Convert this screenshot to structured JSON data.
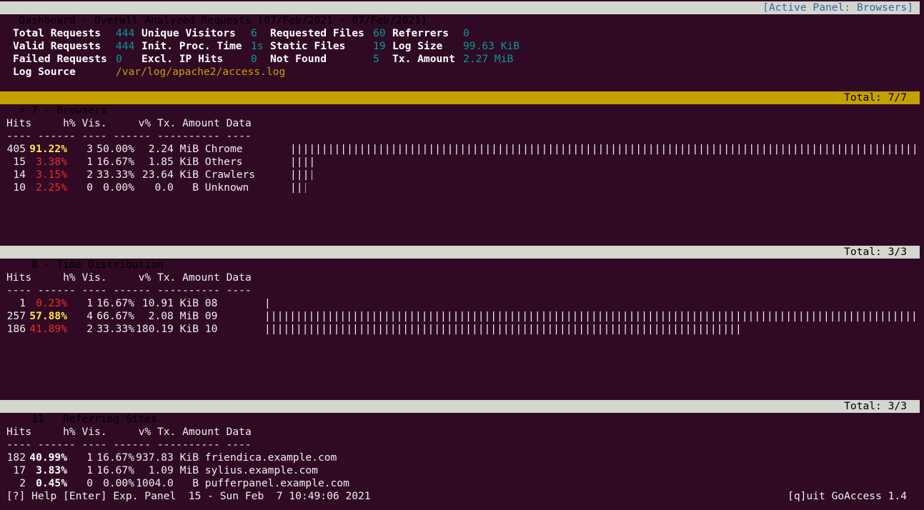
{
  "header": {
    "title": "Dashboard - Overall Analyzed Requests (07/Feb/2021 - 07/Feb/2021)",
    "active_panel": "[Active Panel: Browsers]"
  },
  "overview": {
    "total_requests_label": "Total Requests",
    "total_requests": "444",
    "unique_visitors_label": "Unique Visitors",
    "unique_visitors": "6",
    "requested_files_label": "Requested Files",
    "requested_files": "60",
    "referrers_label": "Referrers",
    "referrers": "0",
    "valid_requests_label": "Valid Requests",
    "valid_requests": "444",
    "init_proc_label": "Init. Proc. Time",
    "init_proc": "1s",
    "static_files_label": "Static Files",
    "static_files": "19",
    "log_size_label": "Log Size",
    "log_size": "99.63 KiB",
    "failed_requests_label": "Failed Requests",
    "failed_requests": "0",
    "excl_ip_label": "Excl. IP Hits",
    "excl_ip": "0",
    "not_found_label": "Not Found",
    "not_found": "5",
    "tx_amount_label": "Tx. Amount",
    "tx_amount": "2.27 MiB",
    "log_source_label": "Log Source",
    "log_source": "/var/log/apache2/access.log"
  },
  "columns": {
    "hits": "Hits",
    "hpct": "h%",
    "vis": "Vis.",
    "vpct": "v%",
    "tx": "Tx. Amount",
    "data": "Data",
    "sep": "---- ------ ---- ------ ---------- ----"
  },
  "panels": {
    "browsers": {
      "title": "> 7 - Browsers",
      "total": "Total: 7/7",
      "rows": [
        {
          "hits": "405",
          "hpct": "91.22%",
          "vis": "3",
          "vpct": "50.00%",
          "tx": "2.24 MiB",
          "data": "Chrome",
          "bar": 1.0
        },
        {
          "hits": "15",
          "hpct": "3.38%",
          "vis": "1",
          "vpct": "16.67%",
          "tx": "1.85 KiB",
          "data": "Others",
          "bar": 0.037
        },
        {
          "hits": "14",
          "hpct": "3.15%",
          "vis": "2",
          "vpct": "33.33%",
          "tx": "23.64 KiB",
          "data": "Crawlers",
          "bar": 0.035
        },
        {
          "hits": "10",
          "hpct": "2.25%",
          "vis": "0",
          "vpct": "0.00%",
          "tx": "0.0   B",
          "data": "Unknown",
          "bar": 0.025
        }
      ]
    },
    "time": {
      "title": "  8 - Time Distribution",
      "total": "Total: 3/3",
      "rows": [
        {
          "hits": "1",
          "hpct": "0.23%",
          "vis": "1",
          "vpct": "16.67%",
          "tx": "10.91 KiB",
          "data": "08",
          "bar": 0.004
        },
        {
          "hits": "257",
          "hpct": "57.88%",
          "vis": "4",
          "vpct": "66.67%",
          "tx": "2.08 MiB",
          "data": "09",
          "bar": 1.0
        },
        {
          "hits": "186",
          "hpct": "41.89%",
          "vis": "2",
          "vpct": "33.33%",
          "tx": "180.19 KiB",
          "data": "10",
          "bar": 0.724
        }
      ]
    },
    "referring": {
      "title": "  11 - Referring Sites",
      "total": "Total: 3/3",
      "rows": [
        {
          "hits": "182",
          "hpct": "40.99%",
          "vis": "1",
          "vpct": "16.67%",
          "tx": "937.83 KiB",
          "data": "friendica.example.com"
        },
        {
          "hits": "17",
          "hpct": "3.83%",
          "vis": "1",
          "vpct": "16.67%",
          "tx": "1.09 MiB",
          "data": "sylius.example.com"
        },
        {
          "hits": "2",
          "hpct": "0.45%",
          "vis": "0",
          "vpct": "0.00%",
          "tx": "1004.0   B",
          "data": "pufferpanel.example.com"
        }
      ]
    }
  },
  "footer": {
    "help": "[?] Help [Enter] Exp. Panel  15 - Sun Feb  7 10:49:06 2021",
    "quit": "[q]uit GoAccess 1.4"
  },
  "colors": {
    "background": "#300a24",
    "active_bar": "#c4a000",
    "header_bar": "#d3d7cf",
    "teal": "#06989a",
    "red": "#ef2929",
    "yellow": "#fce94f"
  }
}
